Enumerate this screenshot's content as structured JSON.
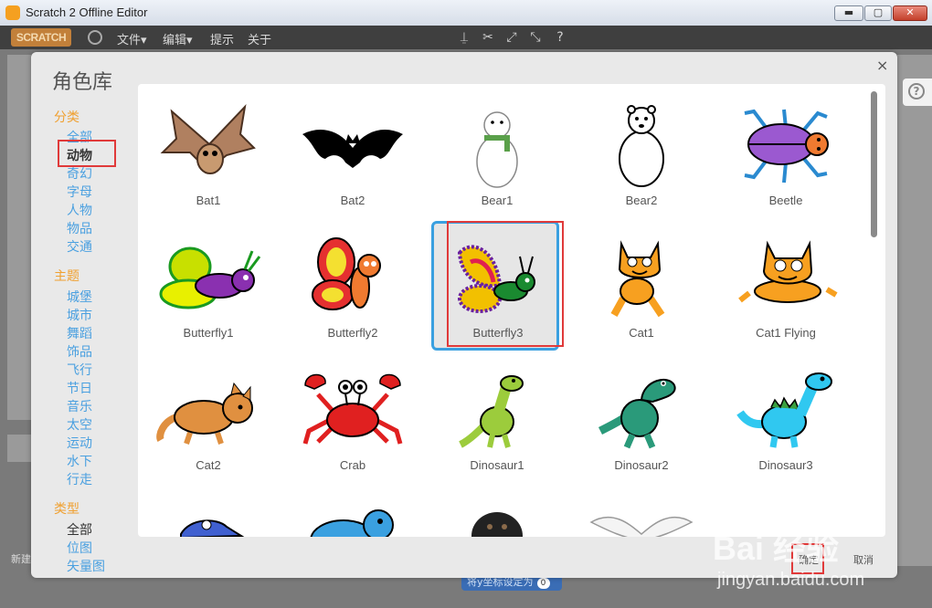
{
  "window": {
    "title": "Scratch 2 Offline Editor",
    "min": "▬",
    "max": "▢",
    "close": "✕"
  },
  "menubar": {
    "logo": "SCRATCH",
    "items": [
      "文件▾",
      "编辑▾",
      "提示",
      "关于"
    ],
    "tools": [
      "stamp-icon",
      "cut-icon",
      "grow-icon",
      "shrink-icon",
      "help-icon"
    ]
  },
  "background": {
    "help": "?",
    "new_label": "新建",
    "block_label": "将y坐标设定为",
    "block_value": "0"
  },
  "dialog": {
    "title": "角色库",
    "close": "×",
    "category_header": "分类",
    "categories": [
      "全部",
      "动物",
      "奇幻",
      "字母",
      "人物",
      "物品",
      "交通"
    ],
    "theme_header": "主题",
    "themes": [
      "城堡",
      "城市",
      "舞蹈",
      "饰品",
      "飞行",
      "节日",
      "音乐",
      "太空",
      "运动",
      "水下",
      "行走"
    ],
    "type_header": "类型",
    "types": [
      "全部",
      "位图",
      "矢量图"
    ],
    "selected_category": "动物",
    "selected_sprite": "Butterfly3",
    "ok": "确定",
    "cancel": "取消"
  },
  "sprites": [
    {
      "name": "Bat1",
      "icon": "bat-brown-icon",
      "color": "#b08060"
    },
    {
      "name": "Bat2",
      "icon": "bat-black-icon",
      "color": "#000000"
    },
    {
      "name": "Bear1",
      "icon": "polar-bear-scarf-icon",
      "color": "#ffffff"
    },
    {
      "name": "Bear2",
      "icon": "polar-bear-icon",
      "color": "#ffffff"
    },
    {
      "name": "Beetle",
      "icon": "beetle-icon",
      "color": "#9b59d0"
    },
    {
      "name": "Butterfly1",
      "icon": "butterfly-green-icon",
      "color": "#c8e000"
    },
    {
      "name": "Butterfly2",
      "icon": "butterfly-red-icon",
      "color": "#e53030"
    },
    {
      "name": "Butterfly3",
      "icon": "butterfly-purple-icon",
      "color": "#f2c000"
    },
    {
      "name": "Cat1",
      "icon": "cat-icon",
      "color": "#f7a020"
    },
    {
      "name": "Cat1 Flying",
      "icon": "cat-flying-icon",
      "color": "#f7a020"
    },
    {
      "name": "Cat2",
      "icon": "cat2-icon",
      "color": "#e09040"
    },
    {
      "name": "Crab",
      "icon": "crab-icon",
      "color": "#e02020"
    },
    {
      "name": "Dinosaur1",
      "icon": "dinosaur-green-icon",
      "color": "#9ccc3c"
    },
    {
      "name": "Dinosaur2",
      "icon": "dinosaur-teal-icon",
      "color": "#2a9a7a"
    },
    {
      "name": "Dinosaur3",
      "icon": "dinosaur-cyan-icon",
      "color": "#30c8f0"
    },
    {
      "name": "",
      "icon": "partial-sprite-icon",
      "color": "#4060d0"
    },
    {
      "name": "",
      "icon": "partial-dog-icon",
      "color": "#3aa0e0"
    },
    {
      "name": "",
      "icon": "partial-puppy-icon",
      "color": "#222222"
    },
    {
      "name": "",
      "icon": "partial-dove-icon",
      "color": "#dddddd"
    }
  ],
  "watermark": {
    "line1": "Bai 经验",
    "line2": "jingyan.baidu.com"
  }
}
